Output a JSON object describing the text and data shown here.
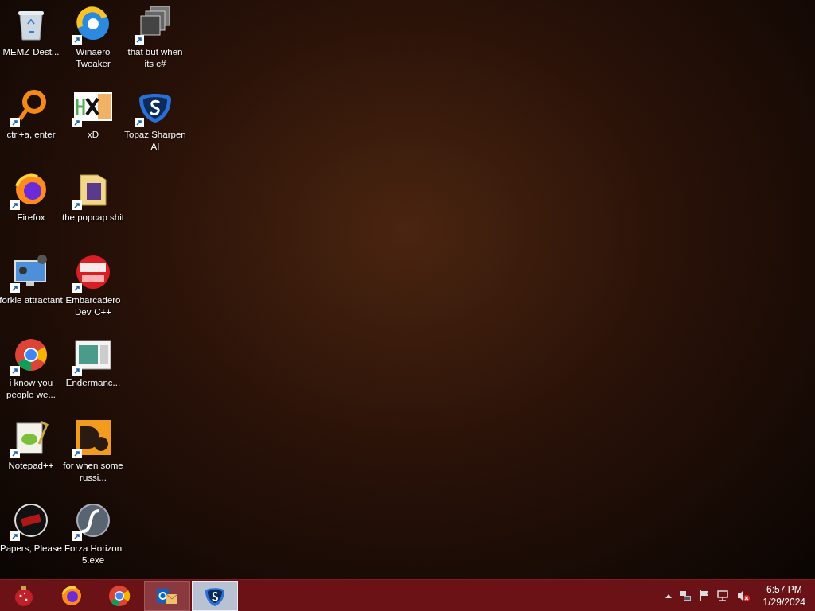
{
  "desktop_icons": [
    {
      "label": "MEMZ-Dest...",
      "shortcut": false
    },
    {
      "label": "ctrl+a, enter",
      "shortcut": true
    },
    {
      "label": "Firefox",
      "shortcut": true
    },
    {
      "label": "forkie attractant",
      "shortcut": true
    },
    {
      "label": "i know you people we...",
      "shortcut": true
    },
    {
      "label": "Notepad++",
      "shortcut": true
    },
    {
      "label": "Papers, Please",
      "shortcut": true
    },
    {
      "label": "Winaero Tweaker",
      "shortcut": true
    },
    {
      "label": "xD",
      "shortcut": true
    },
    {
      "label": "the popcap shit",
      "shortcut": true
    },
    {
      "label": "Embarcadero Dev-C++",
      "shortcut": true
    },
    {
      "label": "Endermanc...",
      "shortcut": true
    },
    {
      "label": "for when some russi...",
      "shortcut": true
    },
    {
      "label": "Forza Horizon 5.exe",
      "shortcut": true
    },
    {
      "label": "that but when its c#",
      "shortcut": true
    },
    {
      "label": "Topaz Sharpen AI",
      "shortcut": true
    }
  ],
  "taskbar": {
    "apps": [
      {
        "running": false,
        "selected": false
      },
      {
        "running": false,
        "selected": false
      },
      {
        "running": false,
        "selected": false
      },
      {
        "running": true,
        "selected": false
      },
      {
        "running": true,
        "selected": true
      }
    ],
    "clock": {
      "time": "6:57 PM",
      "date": "1/29/2024"
    }
  }
}
